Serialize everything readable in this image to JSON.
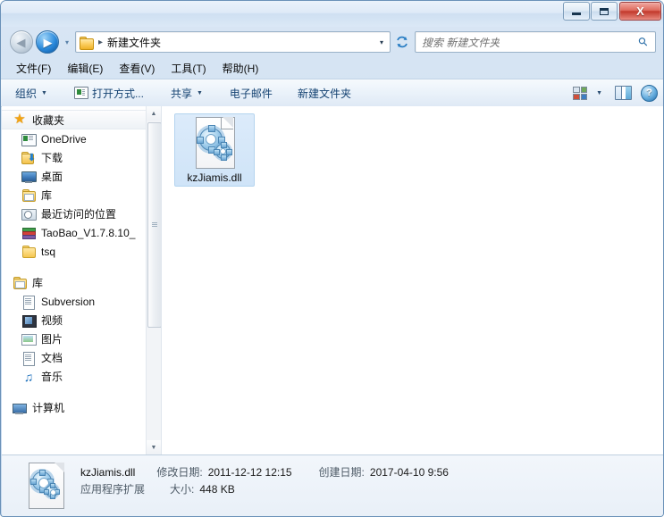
{
  "window": {
    "title": "",
    "buttons": {
      "minimize": "minimize",
      "maximize": "maximize",
      "close": "X"
    }
  },
  "address": {
    "back_tooltip": "后退",
    "forward_tooltip": "前进",
    "crumb_separator": "▸",
    "folder_name": "新建文件夹",
    "dropdown": "▾",
    "refresh": "↻"
  },
  "search": {
    "placeholder": "搜索 新建文件夹",
    "icon": "search-icon"
  },
  "menubar": {
    "items": [
      {
        "label": "文件(F)"
      },
      {
        "label": "编辑(E)"
      },
      {
        "label": "查看(V)"
      },
      {
        "label": "工具(T)"
      },
      {
        "label": "帮助(H)"
      }
    ]
  },
  "toolbar": {
    "organize": "组织",
    "open_with": "打开方式...",
    "share": "共享",
    "email": "电子邮件",
    "new_folder": "新建文件夹",
    "caret": "▼",
    "views_caret": "▼",
    "help_glyph": "?"
  },
  "navpane": {
    "favorites": {
      "label": "收藏夹",
      "icon": "star-icon"
    },
    "favorites_items": [
      {
        "label": "OneDrive",
        "icon": "onedrive-icon"
      },
      {
        "label": "下载",
        "icon": "downloads-icon"
      },
      {
        "label": "桌面",
        "icon": "desktop-icon"
      },
      {
        "label": "库",
        "icon": "library-folder-icon"
      },
      {
        "label": "最近访问的位置",
        "icon": "recent-places-icon"
      },
      {
        "label": "TaoBao_V1.7.8.10_",
        "icon": "archive-icon"
      },
      {
        "label": "tsq",
        "icon": "folder-icon"
      }
    ],
    "libraries": {
      "label": "库",
      "icon": "library-folder-icon"
    },
    "libraries_items": [
      {
        "label": "Subversion",
        "icon": "document-icon"
      },
      {
        "label": "视频",
        "icon": "video-icon"
      },
      {
        "label": "图片",
        "icon": "pictures-icon"
      },
      {
        "label": "文档",
        "icon": "documents-icon"
      },
      {
        "label": "音乐",
        "icon": "music-icon"
      }
    ],
    "computer": {
      "label": "计算机",
      "icon": "computer-icon"
    },
    "scroll_up": "▲",
    "scroll_down": "▼"
  },
  "files": [
    {
      "name": "kzJiamis.dll",
      "icon": "dll-file-icon",
      "selected": true
    }
  ],
  "status": {
    "file_name": "kzJiamis.dll",
    "modified_key": "修改日期:",
    "modified_value": "2011-12-12 12:15",
    "created_key": "创建日期:",
    "created_value": "2017-04-10 9:56",
    "type": "应用程序扩展",
    "size_key": "大小:",
    "size_value": "448 KB"
  },
  "colors": {
    "accent": "#1f7fd0",
    "selection": "#cfe4f8",
    "close_button": "#c2392c",
    "frame": "#c6d9ee"
  }
}
